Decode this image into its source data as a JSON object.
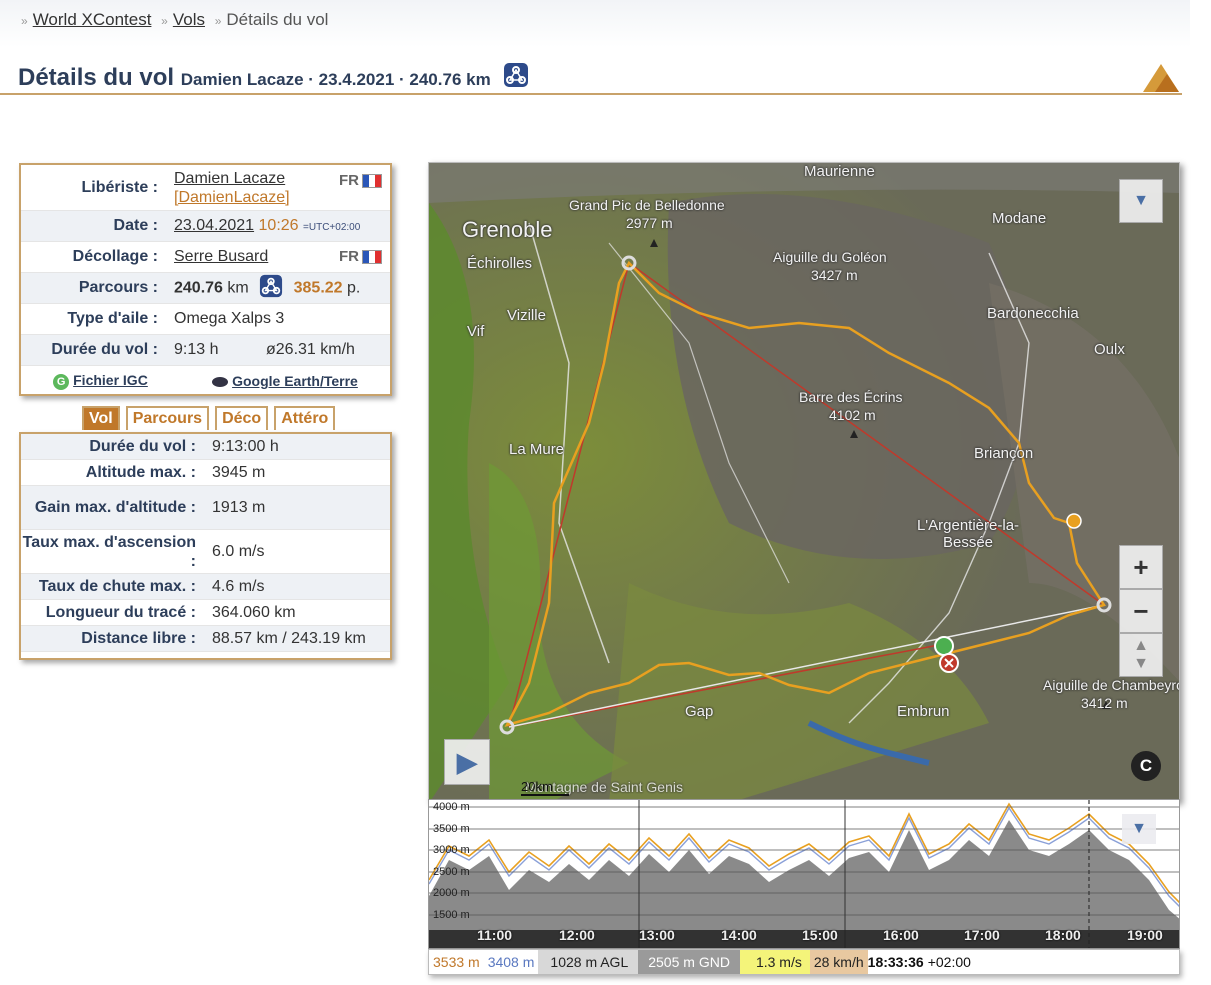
{
  "breadcrumb": {
    "items": [
      "World XContest",
      "Vols",
      "Détails du vol"
    ]
  },
  "header": {
    "title": "Détails du vol",
    "subtitle": "Damien Lacaze · 23.4.2021 · 240.76 km"
  },
  "info": {
    "pilot_label": "Libériste :",
    "pilot_name": "Damien Lacaze",
    "pilot_login": "[DamienLacaze]",
    "pilot_country": "FR",
    "date_label": "Date :",
    "date": "23.04.2021",
    "time": "10:26",
    "utc": "=UTC+02:00",
    "launch_label": "Décollage :",
    "launch": "Serre Busard",
    "launch_country": "FR",
    "route_label": "Parcours :",
    "distance": "240.76",
    "distance_unit": "km",
    "points": "385.22",
    "points_unit": "p.",
    "glider_label": "Type d'aile :",
    "glider": "Omega Xalps 3",
    "duration_label": "Durée du vol :",
    "duration": "9:13 h",
    "avg_speed": "ø26.31 km/h",
    "igc_link": "Fichier IGC",
    "earth_link": "Google Earth/Terre"
  },
  "tabs": [
    "Vol",
    "Parcours",
    "Déco",
    "Attéro"
  ],
  "stats": [
    {
      "label": "Durée du vol :",
      "value": "9:13:00 h"
    },
    {
      "label": "Altitude max. :",
      "value": "3945 m"
    },
    {
      "label": "Gain max. d'altitude :",
      "value": "1913 m"
    },
    {
      "label": "Taux max. d'ascension :",
      "value": "6.0 m/s"
    },
    {
      "label": "Taux de chute max. :",
      "value": "4.6 m/s"
    },
    {
      "label": "Longueur du tracé :",
      "value": "364.060 km"
    },
    {
      "label": "Distance libre :",
      "value": "88.57 km / 243.19 km"
    }
  ],
  "map": {
    "places": [
      "Maurienne",
      "Grand Pic de Belledonne",
      "2977 m",
      "Grenoble",
      "Échirolles",
      "Aiguille du Goléon",
      "3427 m",
      "Modane",
      "Vizille",
      "Vif",
      "Bardonecchia",
      "Oulx",
      "Barre des Écrins",
      "4102 m",
      "La Mure",
      "Briançon",
      "L'Argentière-la-Bessée",
      "Gap",
      "Embrun",
      "Aiguille de Chambeyron",
      "3412 m",
      "Montagne de Saint Genis"
    ],
    "scale": "20km",
    "zoom_in": "+",
    "zoom_out": "−",
    "copyright": "C"
  },
  "altitude_chart": {
    "y_labels": [
      "4000 m",
      "3500 m",
      "3000 m",
      "2500 m",
      "2000 m",
      "1500 m"
    ],
    "x_labels": [
      "11:00",
      "12:00",
      "13:00",
      "14:00",
      "15:00",
      "16:00",
      "17:00",
      "18:00",
      "19:00"
    ]
  },
  "status": {
    "gps_alt": "3533 m",
    "baro_alt": "3408 m",
    "agl": "1028 m AGL",
    "gnd": "2505 m GND",
    "vario": "1.3 m/s",
    "speed": "28 km/h",
    "time": "18:33:36",
    "tz": "+02:00"
  },
  "colors": {
    "accent": "#c0782a",
    "title": "#2d3e5a",
    "track": "#e8a020"
  }
}
